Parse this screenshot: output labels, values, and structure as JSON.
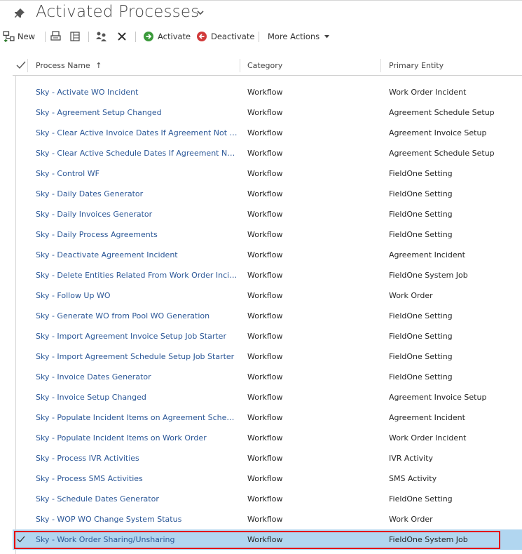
{
  "header": {
    "title": "Activated Processes"
  },
  "toolbar": {
    "new_label": "New",
    "activate_label": "Activate",
    "deactivate_label": "Deactivate",
    "more_actions_label": "More Actions"
  },
  "grid": {
    "columns": [
      "Process Name",
      "Category",
      "Primary Entity"
    ],
    "sort_indicator": "↑",
    "rows": [
      {
        "name": "Sky - Activate WO Incident",
        "category": "Workflow",
        "entity": "Work Order Incident"
      },
      {
        "name": "Sky - Agreement Setup Changed",
        "category": "Workflow",
        "entity": "Agreement Schedule Setup"
      },
      {
        "name": "Sky - Clear Active Invoice Dates If Agreement Not Active",
        "category": "Workflow",
        "entity": "Agreement Invoice Setup"
      },
      {
        "name": "Sky - Clear Active Schedule Dates If Agreement Not Active",
        "category": "Workflow",
        "entity": "Agreement Schedule Setup"
      },
      {
        "name": "Sky - Control WF",
        "category": "Workflow",
        "entity": "FieldOne Setting"
      },
      {
        "name": "Sky - Daily Dates Generator",
        "category": "Workflow",
        "entity": "FieldOne Setting"
      },
      {
        "name": "Sky - Daily Invoices Generator",
        "category": "Workflow",
        "entity": "FieldOne Setting"
      },
      {
        "name": "Sky - Daily Process Agreements",
        "category": "Workflow",
        "entity": "FieldOne Setting"
      },
      {
        "name": "Sky - Deactivate Agreement Incident",
        "category": "Workflow",
        "entity": "Agreement Incident"
      },
      {
        "name": "Sky - Delete Entities Related From Work Order Incident",
        "category": "Workflow",
        "entity": "FieldOne System Job"
      },
      {
        "name": "Sky - Follow Up WO",
        "category": "Workflow",
        "entity": "Work Order"
      },
      {
        "name": "Sky - Generate WO from Pool WO Generation",
        "category": "Workflow",
        "entity": "FieldOne Setting"
      },
      {
        "name": "Sky - Import Agreement Invoice Setup Job Starter",
        "category": "Workflow",
        "entity": "FieldOne Setting"
      },
      {
        "name": "Sky - Import Agreement Schedule Setup Job Starter",
        "category": "Workflow",
        "entity": "FieldOne Setting"
      },
      {
        "name": "Sky - Invoice Dates Generator",
        "category": "Workflow",
        "entity": "FieldOne Setting"
      },
      {
        "name": "Sky - Invoice Setup Changed",
        "category": "Workflow",
        "entity": "Agreement Invoice Setup"
      },
      {
        "name": "Sky - Populate Incident Items on Agreement Schedule Set...",
        "category": "Workflow",
        "entity": "Agreement Incident"
      },
      {
        "name": "Sky - Populate Incident Items on Work Order",
        "category": "Workflow",
        "entity": "Work Order Incident"
      },
      {
        "name": "Sky - Process IVR Activities",
        "category": "Workflow",
        "entity": "IVR Activity"
      },
      {
        "name": "Sky - Process SMS Activities",
        "category": "Workflow",
        "entity": "SMS Activity"
      },
      {
        "name": "Sky - Schedule Dates Generator",
        "category": "Workflow",
        "entity": "FieldOne Setting"
      },
      {
        "name": "Sky - WOP WO Change System Status",
        "category": "Workflow",
        "entity": "Work Order"
      },
      {
        "name": "Sky - Work Order Sharing/Unsharing",
        "category": "Workflow",
        "entity": "FieldOne System Job"
      }
    ]
  }
}
